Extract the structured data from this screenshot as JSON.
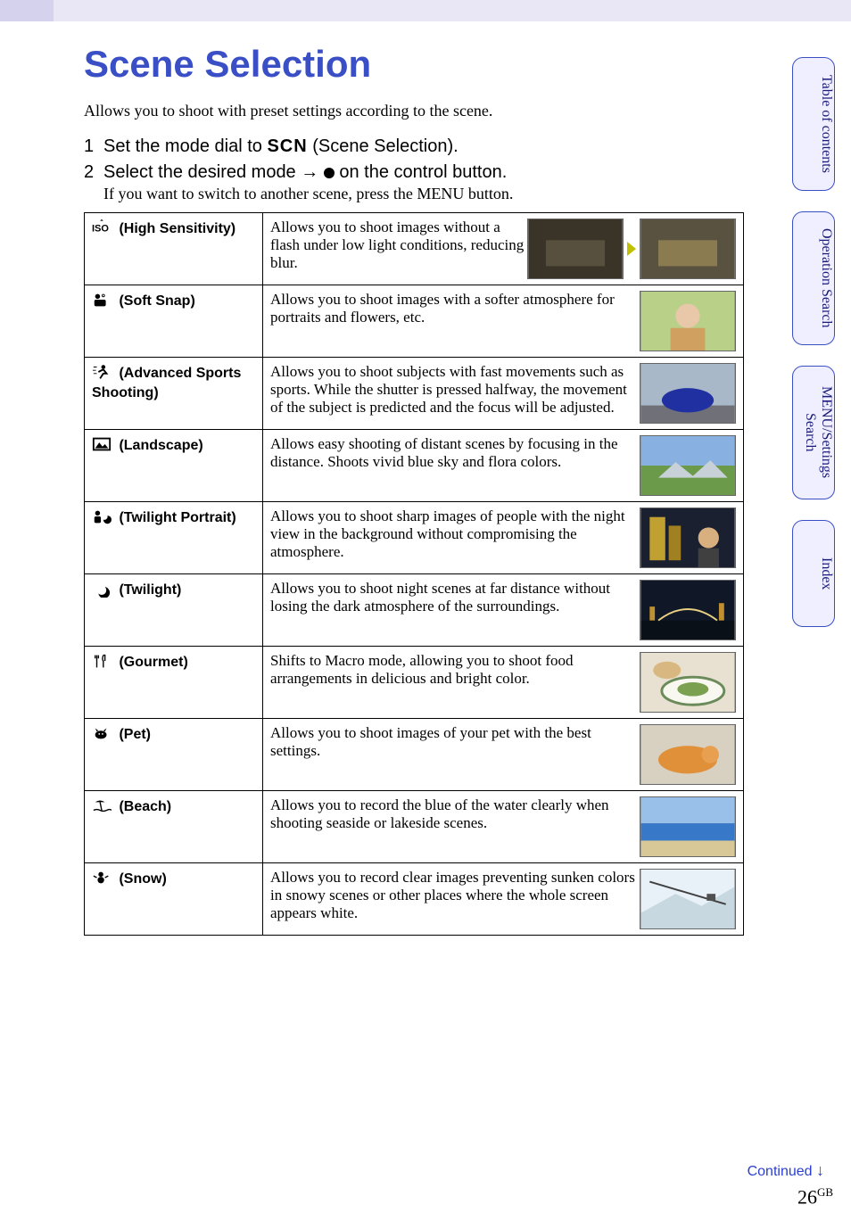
{
  "page": {
    "title": "Scene Selection",
    "intro": "Allows you to shoot with preset settings according to the scene.",
    "pageNumber": "26",
    "pageSuffix": "GB",
    "continued": "Continued"
  },
  "steps": [
    {
      "num": "1",
      "text_pre": "Set the mode dial to ",
      "scn": "SCN",
      "text_post": " (Scene Selection)."
    },
    {
      "num": "2",
      "text_pre": "Select the desired mode ",
      "text_post": " on the control button.",
      "sub": "If you want to switch to another scene, press the MENU button."
    }
  ],
  "scenes": [
    {
      "icon": "iso-icon",
      "label": " (High Sensitivity)",
      "desc": "Allows you to shoot images without a flash under low light conditions, reducing blur.",
      "variant": "high-sens"
    },
    {
      "icon": "soft-snap-icon",
      "label": " (Soft Snap)",
      "desc": "Allows you to shoot images with a softer atmosphere for portraits and flowers, etc."
    },
    {
      "icon": "sports-icon",
      "label": " (Advanced Sports Shooting)",
      "desc": "Allows you to shoot subjects with fast movements such as sports. While the shutter is pressed halfway, the movement of the subject is predicted and the focus will be adjusted."
    },
    {
      "icon": "landscape-icon",
      "label": " (Landscape)",
      "desc": "Allows easy shooting of distant scenes by focusing in the distance. Shoots vivid blue sky and flora colors."
    },
    {
      "icon": "twilight-portrait-icon",
      "label": " (Twilight Portrait)",
      "desc": "Allows you to shoot sharp images of people with the night view in the background without compromising the atmosphere."
    },
    {
      "icon": "twilight-icon",
      "label": " (Twilight)",
      "desc": "Allows you to shoot night scenes at far distance without losing the dark atmosphere of the surroundings."
    },
    {
      "icon": "gourmet-icon",
      "label": " (Gourmet)",
      "desc": "Shifts to Macro mode, allowing you to shoot food arrangements in delicious and bright color."
    },
    {
      "icon": "pet-icon",
      "label": " (Pet)",
      "desc": "Allows you to shoot images of your pet with the best settings."
    },
    {
      "icon": "beach-icon",
      "label": " (Beach)",
      "desc": "Allows you to record the blue of the water clearly when shooting seaside or lakeside scenes."
    },
    {
      "icon": "snow-icon",
      "label": " (Snow)",
      "desc": "Allows you to record clear images preventing sunken colors in snowy scenes or other places where the whole screen appears white."
    }
  ],
  "tabs": [
    {
      "label": "Table of contents"
    },
    {
      "label": "Operation Search"
    },
    {
      "label": "MENU/Settings Search"
    },
    {
      "label": "Index"
    }
  ]
}
